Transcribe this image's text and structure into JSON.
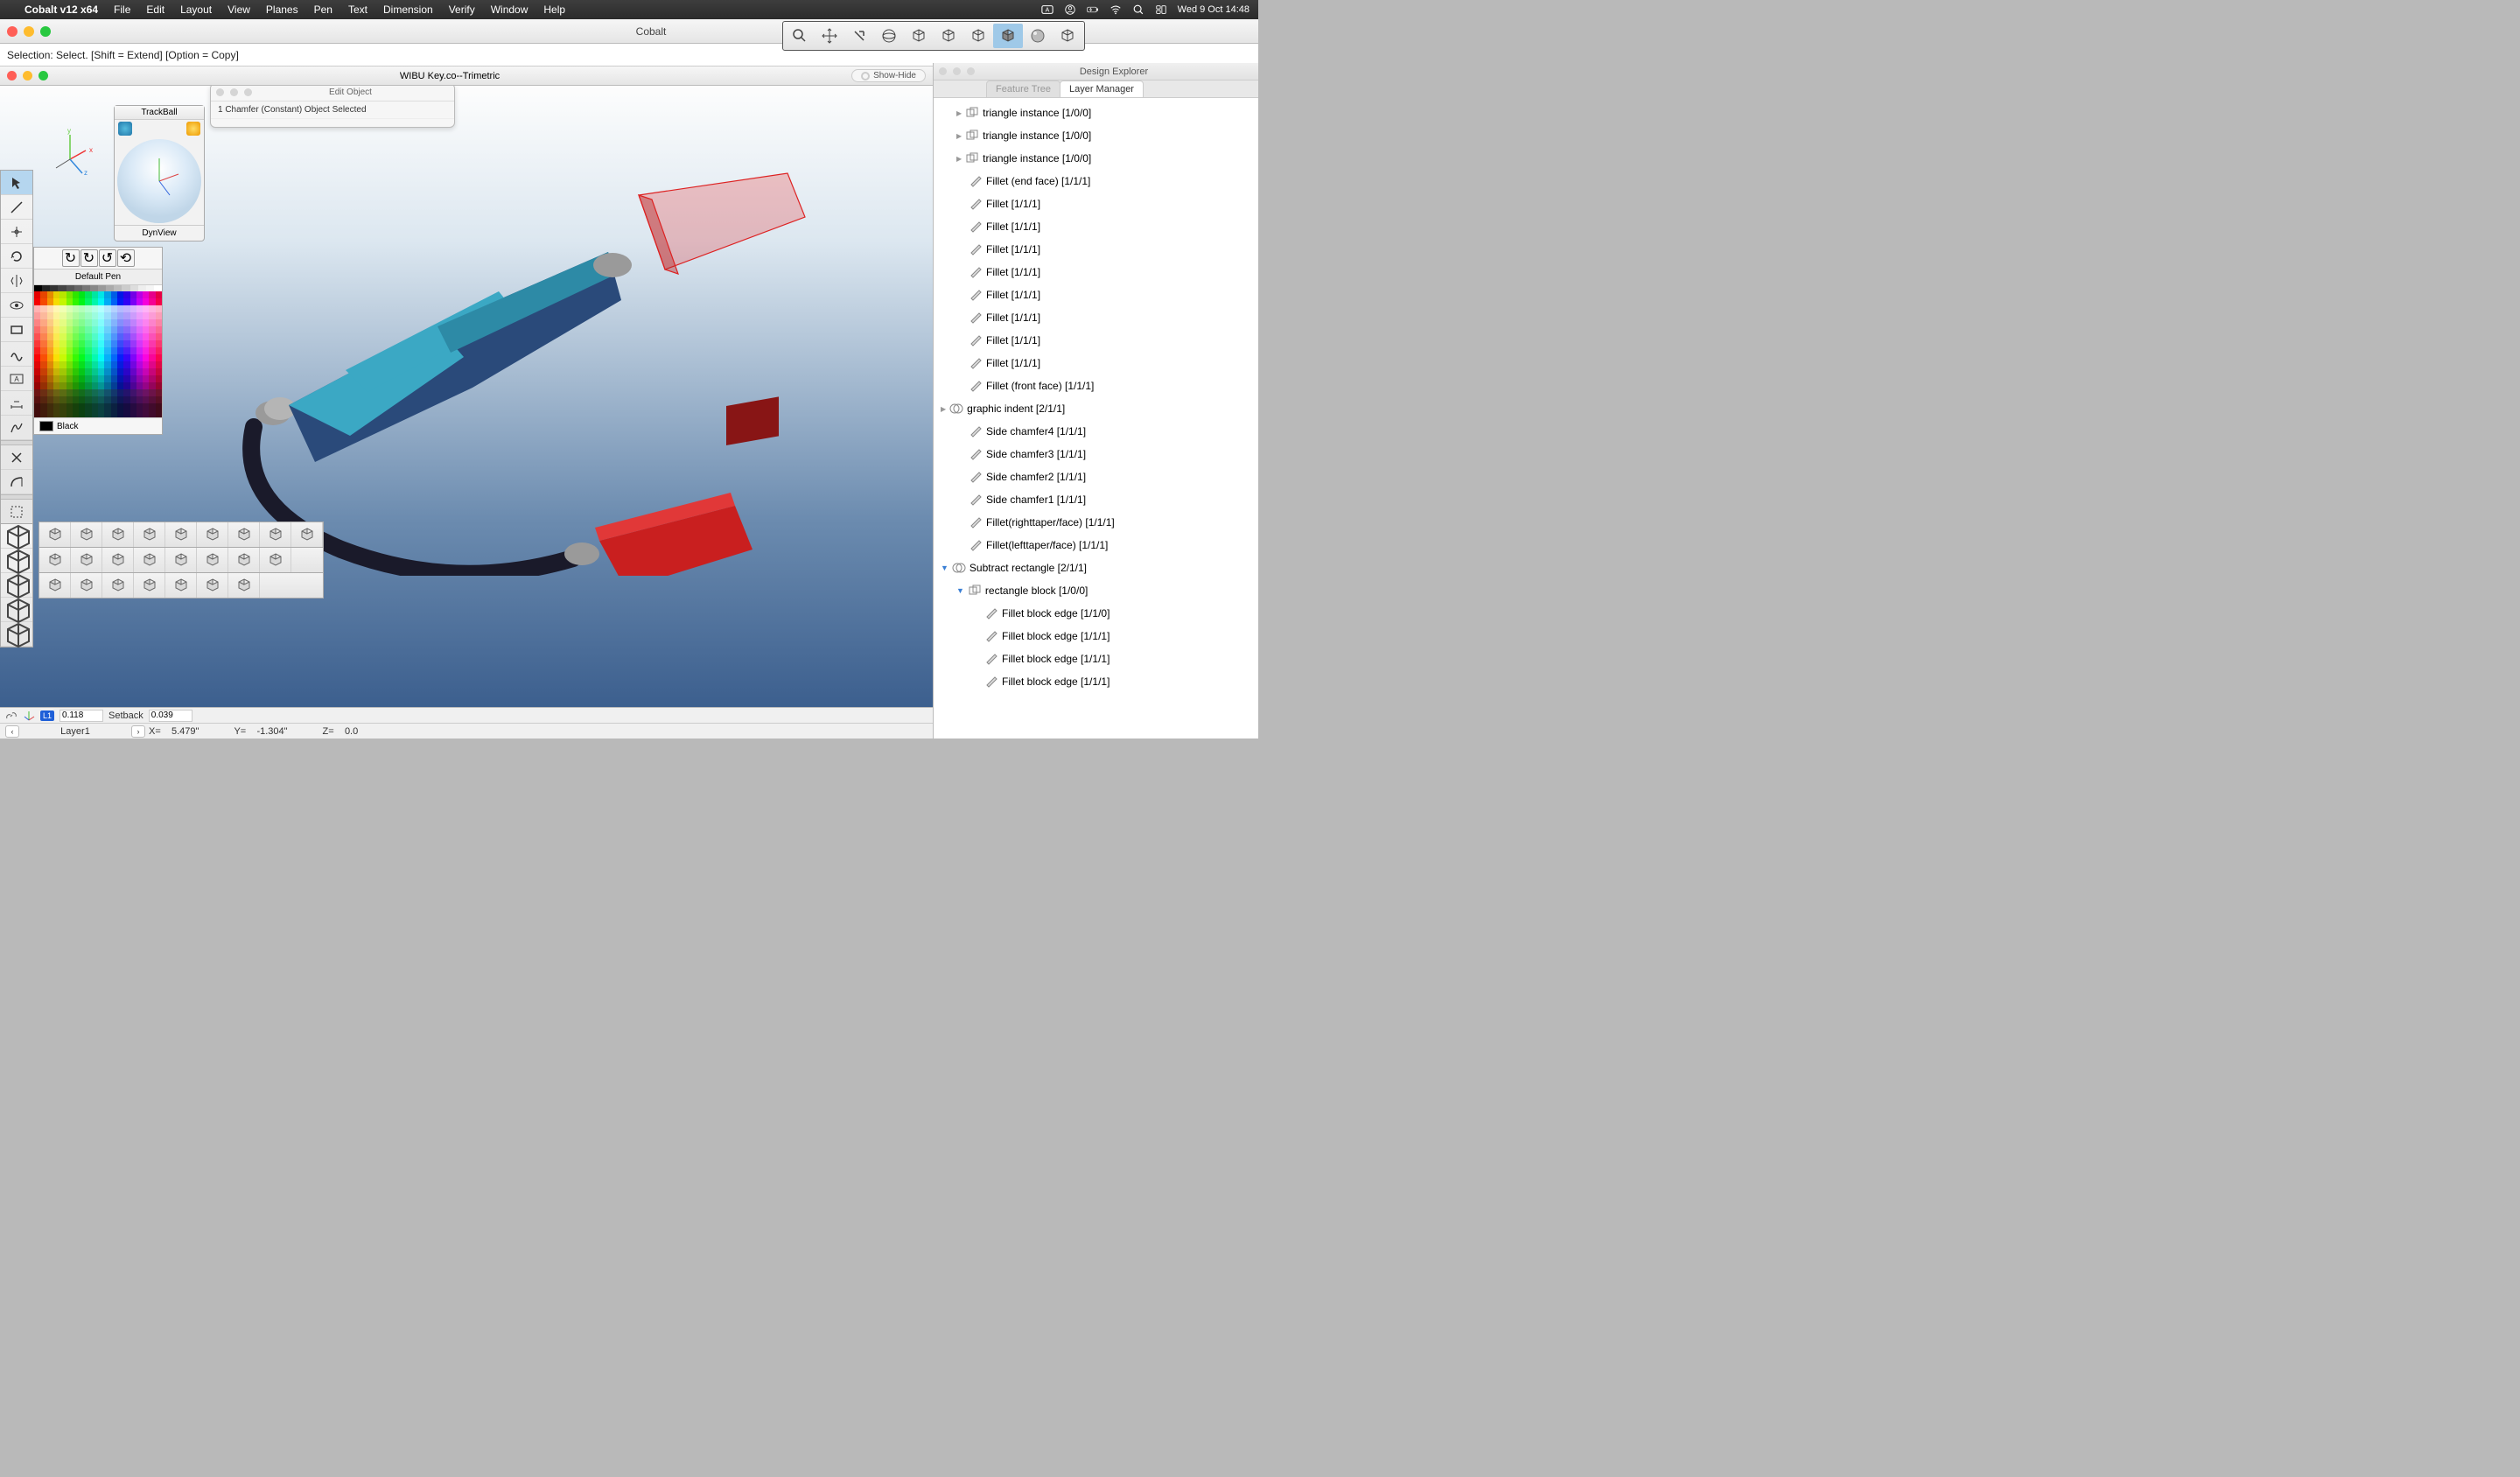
{
  "menubar": {
    "appname": "Cobalt v12 x64",
    "items": [
      "File",
      "Edit",
      "Layout",
      "View",
      "Planes",
      "Pen",
      "Text",
      "Dimension",
      "Verify",
      "Window",
      "Help"
    ],
    "clock": "Wed 9 Oct  14:48"
  },
  "main_window": {
    "title": "Cobalt"
  },
  "hintbar": "Selection: Select. [Shift = Extend] [Option = Copy]",
  "doc_window": {
    "title": "WIBU Key.co--Trimetric",
    "showhide": "Show-Hide"
  },
  "trackball": {
    "title": "TrackBall",
    "footer": "DynView"
  },
  "edit_object": {
    "title": "Edit Object",
    "body": "1 Chamfer (Constant) Object Selected"
  },
  "pen_palette": {
    "title": "Default Pen",
    "current": "Black"
  },
  "statusbar": {
    "layer_badge": "L1",
    "val1": "0.118",
    "setback_label": "Setback",
    "setback_val": "0.039",
    "layer": "Layer1",
    "x_label": "X=",
    "x_val": "5.479\"",
    "y_label": "Y=",
    "y_val": "-1.304\"",
    "z_label": "Z=",
    "z_val": "0.0"
  },
  "explorer": {
    "title": "Design Explorer",
    "tabs": [
      {
        "label": "Feature Tree",
        "active": false
      },
      {
        "label": "Layer Manager",
        "active": true
      }
    ],
    "nodes": [
      {
        "indent": 1,
        "disc": true,
        "icon": "inst",
        "label": "triangle instance [1/0/0]"
      },
      {
        "indent": 1,
        "disc": true,
        "icon": "inst",
        "label": "triangle instance [1/0/0]"
      },
      {
        "indent": 1,
        "disc": true,
        "icon": "inst",
        "label": "triangle instance [1/0/0]"
      },
      {
        "indent": 1,
        "icon": "feat",
        "label": "Fillet (end face) [1/1/1]"
      },
      {
        "indent": 1,
        "icon": "feat",
        "label": "Fillet [1/1/1]"
      },
      {
        "indent": 1,
        "icon": "feat",
        "label": "Fillet [1/1/1]"
      },
      {
        "indent": 1,
        "icon": "feat",
        "label": "Fillet [1/1/1]"
      },
      {
        "indent": 1,
        "icon": "feat",
        "label": "Fillet [1/1/1]"
      },
      {
        "indent": 1,
        "icon": "feat",
        "label": "Fillet [1/1/1]"
      },
      {
        "indent": 1,
        "icon": "feat",
        "label": "Fillet [1/1/1]"
      },
      {
        "indent": 1,
        "icon": "feat",
        "label": "Fillet [1/1/1]"
      },
      {
        "indent": 1,
        "icon": "feat",
        "label": "Fillet [1/1/1]"
      },
      {
        "indent": 1,
        "icon": "feat",
        "label": "Fillet (front face) [1/1/1]"
      },
      {
        "indent": 0,
        "disc": true,
        "icon": "bool",
        "label": "graphic indent [2/1/1]"
      },
      {
        "indent": 1,
        "icon": "feat",
        "label": "Side chamfer4 [1/1/1]"
      },
      {
        "indent": 1,
        "icon": "feat",
        "label": "Side chamfer3 [1/1/1]"
      },
      {
        "indent": 1,
        "icon": "feat",
        "label": "Side chamfer2 [1/1/1]"
      },
      {
        "indent": 1,
        "icon": "feat",
        "label": "Side chamfer1 [1/1/1]"
      },
      {
        "indent": 1,
        "icon": "feat",
        "label": "Fillet(righttaper/face) [1/1/1]"
      },
      {
        "indent": 1,
        "icon": "feat",
        "label": "Fillet(lefttaper/face) [1/1/1]"
      },
      {
        "indent": 0,
        "disc": true,
        "expanded": true,
        "icon": "bool",
        "label": "Subtract rectangle [2/1/1]"
      },
      {
        "indent": 1,
        "disc": true,
        "expanded": true,
        "icon": "inst",
        "label": "rectangle block [1/0/0]"
      },
      {
        "indent": 2,
        "icon": "feat",
        "label": "Fillet block edge [1/1/0]"
      },
      {
        "indent": 2,
        "icon": "feat",
        "label": "Fillet block edge [1/1/1]"
      },
      {
        "indent": 2,
        "icon": "feat",
        "label": "Fillet block edge [1/1/1]"
      },
      {
        "indent": 2,
        "icon": "feat",
        "label": "Fillet block edge [1/1/1]"
      }
    ]
  },
  "view_toolbar": [
    "zoom",
    "pan",
    "rotate-view",
    "sphere-view",
    "iso-view",
    "front-cube",
    "right-cube",
    "shaded-cube",
    "render-sphere",
    "back-cube"
  ],
  "view_toolbar_active": 7,
  "left_tools": [
    "arrow",
    "line",
    "move",
    "rotate",
    "mirror",
    "eye",
    "rect",
    "wave",
    "textbox",
    "dim",
    "spline",
    "sep",
    "delete",
    "arc",
    "sep",
    "select-box"
  ],
  "solid_tools": [
    "cube",
    "lathe",
    "extrude",
    "cut",
    "boolean"
  ],
  "solid_rows": [
    [
      "sphere",
      "bevelbox",
      "cube",
      "cylinder",
      "cone",
      "torus",
      "capsule",
      "gem",
      "blend"
    ],
    [
      "sweep",
      "offset",
      "extrude",
      "revolve",
      "loft",
      "shell",
      "pipe",
      "coil"
    ],
    [
      "blend2",
      "fillet",
      "chamfer",
      "hollow",
      "section",
      "measure",
      "pattern"
    ]
  ],
  "colors": {
    "grays": [
      "#000",
      "#222",
      "#333",
      "#444",
      "#555",
      "#666",
      "#777",
      "#888",
      "#999",
      "#aaa",
      "#bbb",
      "#ccc",
      "#ddd",
      "#eee",
      "#f5f5f5",
      "#fff"
    ],
    "hues_base": [
      0,
      18,
      36,
      54,
      72,
      90,
      108,
      126,
      144,
      162,
      180,
      198,
      216,
      234,
      252,
      270,
      288,
      306,
      324,
      342
    ]
  }
}
